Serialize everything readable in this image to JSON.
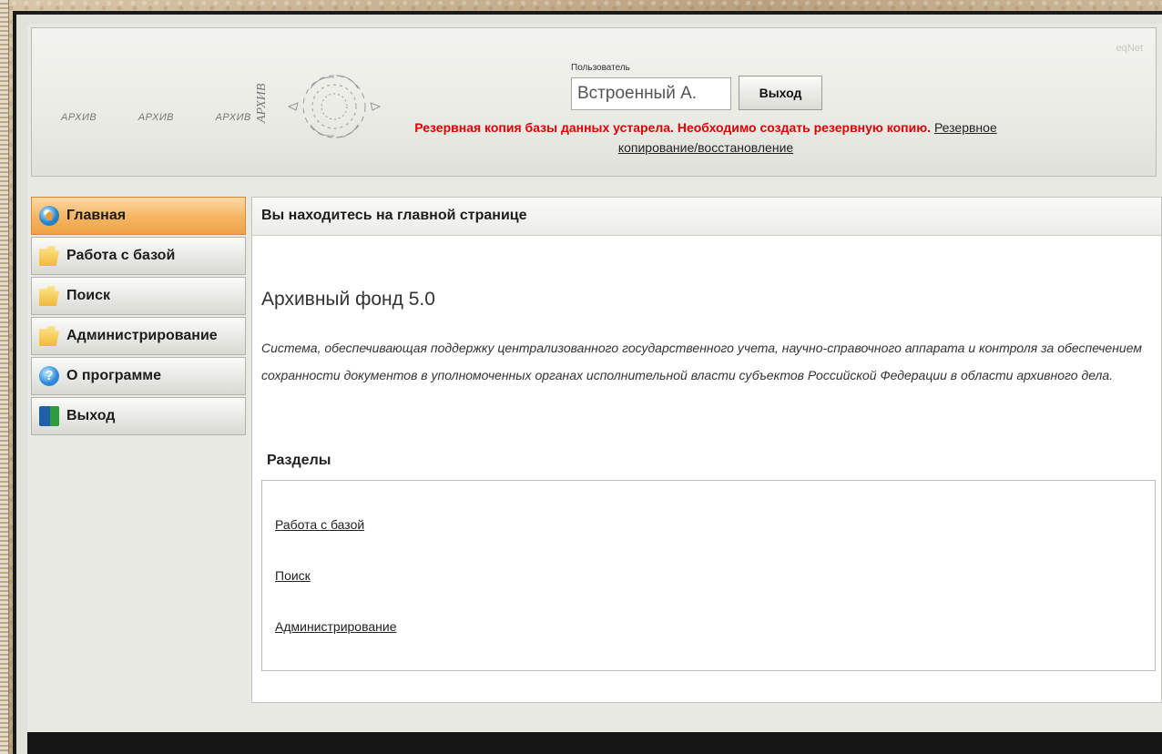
{
  "header": {
    "logo_words": [
      "АРХИВ",
      "АРХИВ",
      "АРХИВ"
    ],
    "logo_vertical_word": "АРХИВ",
    "brand": "eqNet",
    "user_label": "Пользователь",
    "user_value": "Встроенный А.",
    "logout_label": "Выход",
    "warning_text": "Резервная копия базы данных устарела. Необходимо создать резервную копию.",
    "warning_link": "Резервное копирование/восстановление"
  },
  "sidebar": {
    "items": [
      {
        "label": "Главная",
        "icon": "home-icon",
        "active": true
      },
      {
        "label": "Работа с базой",
        "icon": "folder-icon"
      },
      {
        "label": "Поиск",
        "icon": "folder-icon"
      },
      {
        "label": "Администрирование",
        "icon": "folder-icon"
      },
      {
        "label": "О программе",
        "icon": "help-icon"
      },
      {
        "label": "Выход",
        "icon": "exit-icon"
      }
    ]
  },
  "main": {
    "location": "Вы находитесь на главной странице",
    "app_title": "Архивный фонд 5.0",
    "description": "Система, обеспечивающая поддержку централизованного государственного учета, научно-справочного аппарата и контроля за обеспечением сохранности документов в уполномоченных органах исполнительной власти субъектов Российской Федерации в области архивного дела.",
    "sections_title": "Разделы",
    "sections": [
      "Работа с базой",
      "Поиск",
      "Администрирование"
    ]
  },
  "colors": {
    "warning": "#e00000",
    "active_nav": "#f6b765"
  }
}
